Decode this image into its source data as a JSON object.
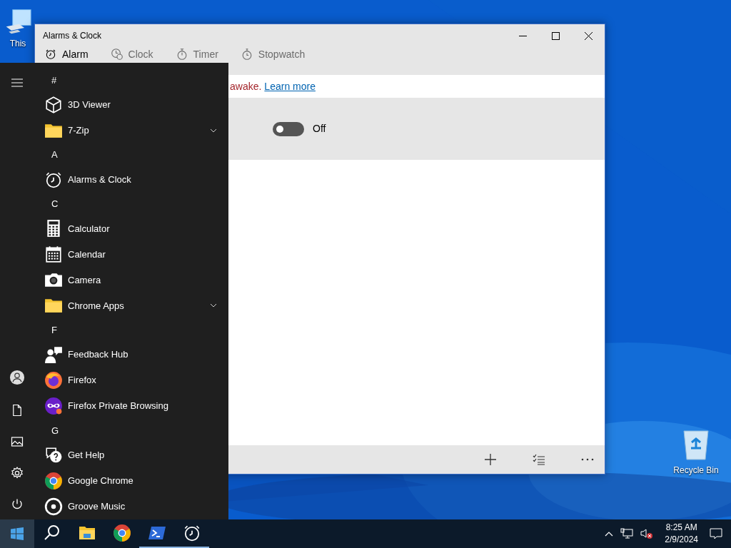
{
  "desktop_icons": [
    {
      "label": "This"
    },
    {
      "label": "Recycle Bin"
    }
  ],
  "window": {
    "title": "Alarms & Clock",
    "tabs": [
      {
        "label": "Alarm",
        "selected": true
      },
      {
        "label": "Clock",
        "selected": false
      },
      {
        "label": "Timer",
        "selected": false
      },
      {
        "label": "Stopwatch",
        "selected": false
      }
    ],
    "notice": {
      "text": "awake.",
      "link": "Learn more"
    },
    "alarm": {
      "on": false,
      "state_label": "Off"
    }
  },
  "start_menu": {
    "groups": [
      {
        "letter": "#",
        "items": [
          {
            "label": "3D Viewer",
            "kind": "app"
          },
          {
            "label": "7-Zip",
            "kind": "folder"
          }
        ]
      },
      {
        "letter": "A",
        "items": [
          {
            "label": "Alarms & Clock",
            "kind": "app"
          }
        ]
      },
      {
        "letter": "C",
        "items": [
          {
            "label": "Calculator",
            "kind": "app"
          },
          {
            "label": "Calendar",
            "kind": "app"
          },
          {
            "label": "Camera",
            "kind": "app"
          },
          {
            "label": "Chrome Apps",
            "kind": "folder"
          }
        ]
      },
      {
        "letter": "F",
        "items": [
          {
            "label": "Feedback Hub",
            "kind": "app"
          },
          {
            "label": "Firefox",
            "kind": "app"
          },
          {
            "label": "Firefox Private Browsing",
            "kind": "app"
          }
        ]
      },
      {
        "letter": "G",
        "items": [
          {
            "label": "Get Help",
            "kind": "app"
          },
          {
            "label": "Google Chrome",
            "kind": "app"
          },
          {
            "label": "Groove Music",
            "kind": "app"
          }
        ]
      }
    ]
  },
  "taskbar": {
    "start_button": {
      "selected": true
    },
    "apps": [
      {
        "running": false
      },
      {
        "running": false
      },
      {
        "running": false
      },
      {
        "running": true
      },
      {
        "running": true
      }
    ],
    "time": "8:25 AM",
    "date": "2/9/2024"
  }
}
